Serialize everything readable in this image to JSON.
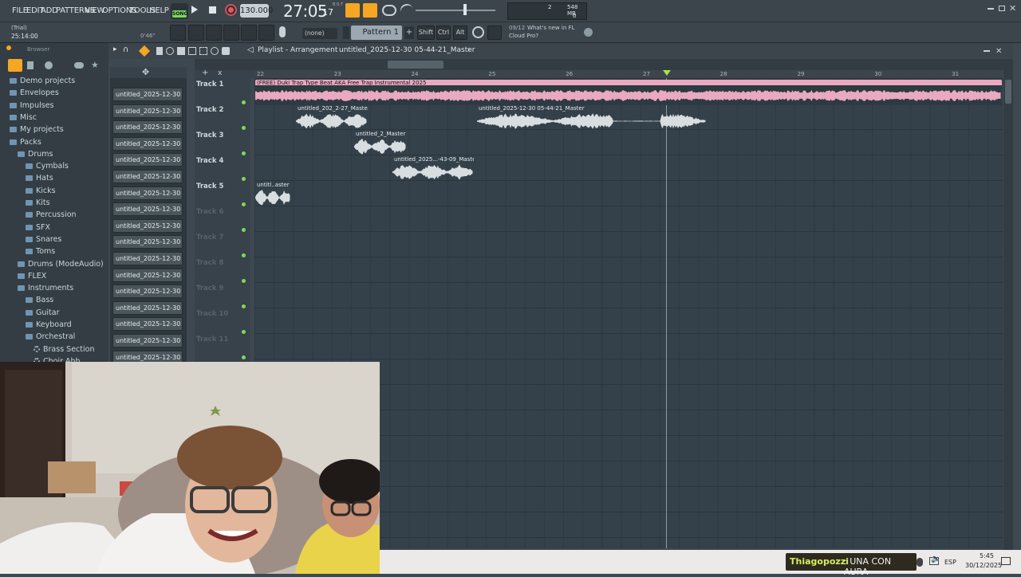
{
  "menu": {
    "items": [
      "FILE",
      "EDIT",
      "ADD",
      "PATTERNS",
      "VIEW",
      "OPTIONS",
      "TOOLS",
      "HELP"
    ]
  },
  "transport": {
    "mode": "SONG",
    "tempo": "130.000",
    "time": "27:05",
    "time_sub": "17",
    "time_label": "B:S:T",
    "cpu_value": "2",
    "mem": "548 MB",
    "mem_value": "0"
  },
  "hint": {
    "line1": "(Trial)",
    "line2": "25:14:00",
    "duration": "0'46\""
  },
  "toolbar2": {
    "snap": "(none)",
    "pattern": "Pattern 1",
    "shift": "Shift",
    "ctrl": "Ctrl",
    "alt": "Alt",
    "news_count": "09/12",
    "news_text1": "What's new in FL",
    "news_text2": "Cloud Pro?"
  },
  "browser": {
    "title": "Browser",
    "items": [
      {
        "label": "Demo projects",
        "kind": "folder",
        "indent": 0
      },
      {
        "label": "Envelopes",
        "kind": "folder",
        "indent": 0
      },
      {
        "label": "Impulses",
        "kind": "folder",
        "indent": 0
      },
      {
        "label": "Misc",
        "kind": "folder",
        "indent": 0
      },
      {
        "label": "My projects",
        "kind": "folder",
        "indent": 0
      },
      {
        "label": "Packs",
        "kind": "folder",
        "indent": 0
      },
      {
        "label": "Drums",
        "kind": "folder",
        "indent": 1
      },
      {
        "label": "Cymbals",
        "kind": "folder",
        "indent": 2
      },
      {
        "label": "Hats",
        "kind": "folder",
        "indent": 2
      },
      {
        "label": "Kicks",
        "kind": "folder",
        "indent": 2
      },
      {
        "label": "Kits",
        "kind": "folder",
        "indent": 2
      },
      {
        "label": "Percussion",
        "kind": "folder",
        "indent": 2
      },
      {
        "label": "SFX",
        "kind": "folder",
        "indent": 2
      },
      {
        "label": "Snares",
        "kind": "folder",
        "indent": 2
      },
      {
        "label": "Toms",
        "kind": "folder",
        "indent": 2
      },
      {
        "label": "Drums (ModeAudio)",
        "kind": "folder",
        "indent": 1
      },
      {
        "label": "FLEX",
        "kind": "folder",
        "indent": 1
      },
      {
        "label": "Instruments",
        "kind": "folder",
        "indent": 1
      },
      {
        "label": "Bass",
        "kind": "folder",
        "indent": 2
      },
      {
        "label": "Guitar",
        "kind": "folder",
        "indent": 2
      },
      {
        "label": "Keyboard",
        "kind": "folder",
        "indent": 2
      },
      {
        "label": "Orchestral",
        "kind": "folder",
        "indent": 2
      },
      {
        "label": "Brass Section",
        "kind": "gear",
        "indent": 3
      },
      {
        "label": "Choir Ahh",
        "kind": "gear",
        "indent": 3
      }
    ]
  },
  "picker": {
    "items": [
      "untitled_2025-12-30 05-",
      "untitled_2025-12-30 05-",
      "untitled_2025-12-30 05-",
      "untitled_2025-12-30 05-",
      "untitled_2025-12-30 05-",
      "untitled_2025-12-30 05-",
      "untitled_2025-12-30 05-",
      "untitled_2025-12-30 05-",
      "untitled_2025-12-30 05-",
      "untitled_2025-12-30 05-",
      "untitled_2025-12-30 05-",
      "untitled_2025-12-30 05-",
      "untitled_2025-12-30 05-",
      "untitled_2025-12-30 05-",
      "untitled_2025-12-30 05-",
      "untitled_2025-12-30 05-",
      "untitled_2025-12-30 05-"
    ]
  },
  "playlist": {
    "title": "Playlist - Arrangement",
    "breadcrumb": "untitled_2025-12-30 05-44-21_Master",
    "ruler": [
      "22",
      "23",
      "24",
      "25",
      "26",
      "27",
      "28",
      "29",
      "30",
      "31"
    ],
    "tracks": [
      {
        "name": "Track 1",
        "active": true
      },
      {
        "name": "Track 2",
        "active": true
      },
      {
        "name": "Track 3",
        "active": true
      },
      {
        "name": "Track 4",
        "active": true
      },
      {
        "name": "Track 5",
        "active": true
      },
      {
        "name": "Track 6",
        "active": false
      },
      {
        "name": "Track 7",
        "active": false
      },
      {
        "name": "Track 8",
        "active": false
      },
      {
        "name": "Track 9",
        "active": false
      },
      {
        "name": "Track 10",
        "active": false
      },
      {
        "name": "Track 11",
        "active": false
      }
    ],
    "clips": [
      {
        "title": "(FREE) Duki Trap Type Beat AKA  Free Trap Instrumental 2025",
        "track": 1,
        "color": "#e9a9bf"
      },
      {
        "title": "untitled_202_2-27_Master",
        "track": 2,
        "color": "#d8dde0"
      },
      {
        "title": "untitled_2025-12-30 05-44-21_Master",
        "track": 2,
        "color": "#d8dde0"
      },
      {
        "title": "untitled_2_Master",
        "track": 3,
        "color": "#d8dde0"
      },
      {
        "title": "untitled_2025...-43-09_Master",
        "track": 4,
        "color": "#d8dde0"
      },
      {
        "title": "untitl..aster",
        "track": 5,
        "color": "#d8dde0"
      }
    ]
  },
  "taskbar": {
    "chat_user": "Thiagopozzi",
    "chat_text": ": UNA CON AURA",
    "lang": "ESP",
    "time": "5:45",
    "date": "30/12/2025"
  },
  "colors": {
    "accent": "#f5a623",
    "song": "#7ed957",
    "clip_pink": "#e9a9bf"
  }
}
